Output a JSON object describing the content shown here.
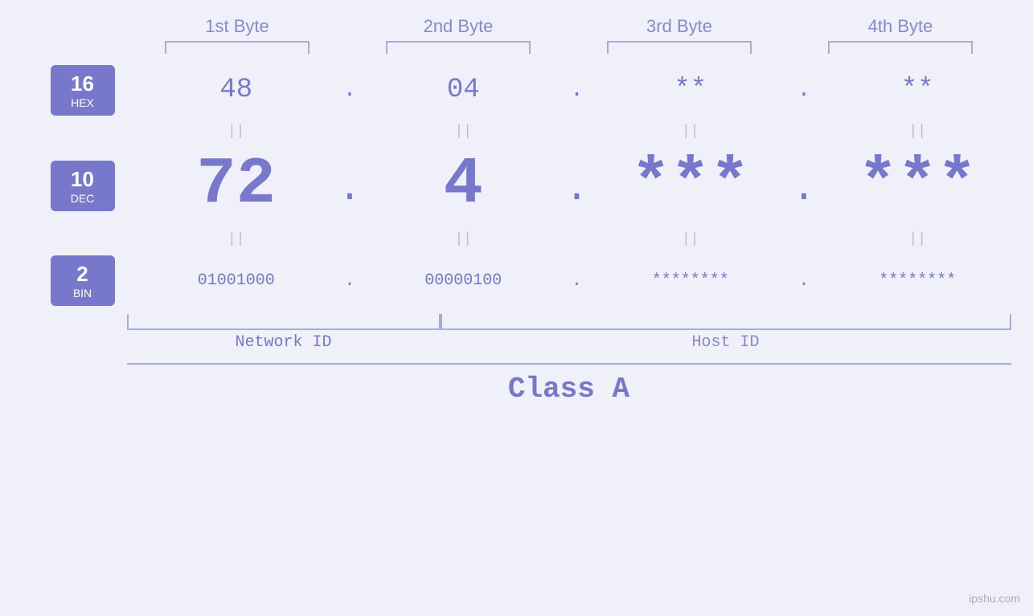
{
  "header": {
    "byte1": "1st Byte",
    "byte2": "2nd Byte",
    "byte3": "3rd Byte",
    "byte4": "4th Byte"
  },
  "labels": {
    "hex": {
      "num": "16",
      "base": "HEX"
    },
    "dec": {
      "num": "10",
      "base": "DEC"
    },
    "bin": {
      "num": "2",
      "base": "BIN"
    }
  },
  "hex_row": {
    "b1": "48",
    "b2": "04",
    "b3": "**",
    "b4": "**",
    "sep1": ".",
    "sep2": ".",
    "sep3": ".",
    "sep4": "."
  },
  "dec_row": {
    "b1": "72",
    "b2": "4",
    "b3": "***",
    "b4": "***",
    "sep1": ".",
    "sep2": ".",
    "sep3": ".",
    "sep4": "."
  },
  "bin_row": {
    "b1": "01001000",
    "b2": "00000100",
    "b3": "********",
    "b4": "********",
    "sep1": ".",
    "sep2": ".",
    "sep3": ".",
    "sep4": "."
  },
  "pipe_symbol": "||",
  "network_id": "Network ID",
  "host_id": "Host ID",
  "class_label": "Class A",
  "watermark": "ipshu.com"
}
